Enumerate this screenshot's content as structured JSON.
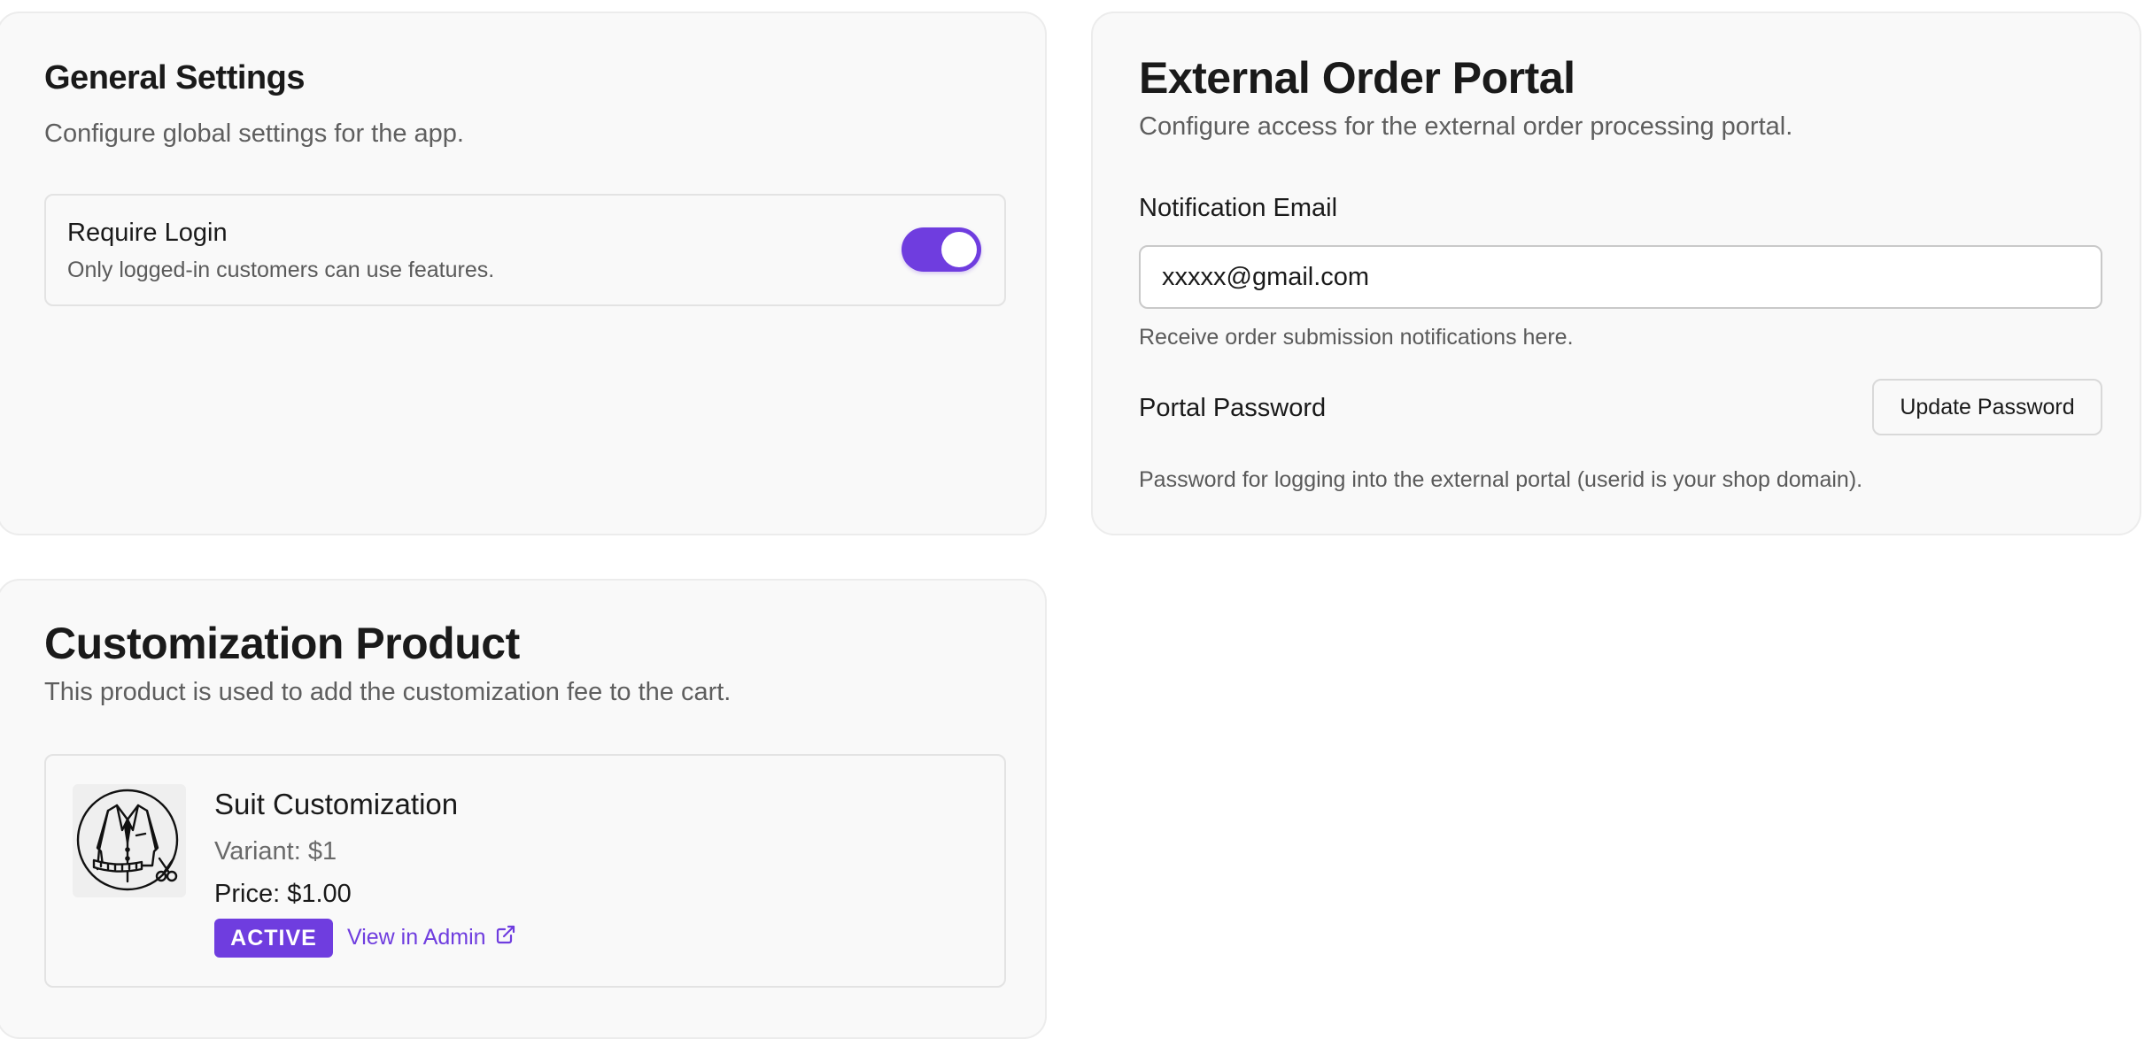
{
  "general_settings": {
    "title": "General Settings",
    "description": "Configure global settings for the app.",
    "require_login": {
      "label": "Require Login",
      "description": "Only logged-in customers can use features.",
      "enabled": true
    }
  },
  "external_portal": {
    "title": "External Order Portal",
    "description": "Configure access for the external order processing portal.",
    "notification_email": {
      "label": "Notification Email",
      "value": "xxxxx@gmail.com",
      "help": "Receive order submission notifications here."
    },
    "portal_password": {
      "label": "Portal Password",
      "button_label": "Update Password",
      "help": "Password for logging into the external portal (userid is your shop domain)."
    }
  },
  "customization_product": {
    "title": "Customization Product",
    "description": "This product is used to add the customization fee to the cart.",
    "product": {
      "name": "Suit Customization",
      "variant": "Variant: $1",
      "price_label": "Price:",
      "price_value": "$1.00",
      "status": "ACTIVE",
      "admin_link": "View in Admin",
      "thumbnail_icon": "suit-jacket-scissors-icon",
      "link_icon": "external-link-icon"
    }
  },
  "colors": {
    "accent": "#6f3ddf",
    "card_background": "#f9f9f9"
  }
}
